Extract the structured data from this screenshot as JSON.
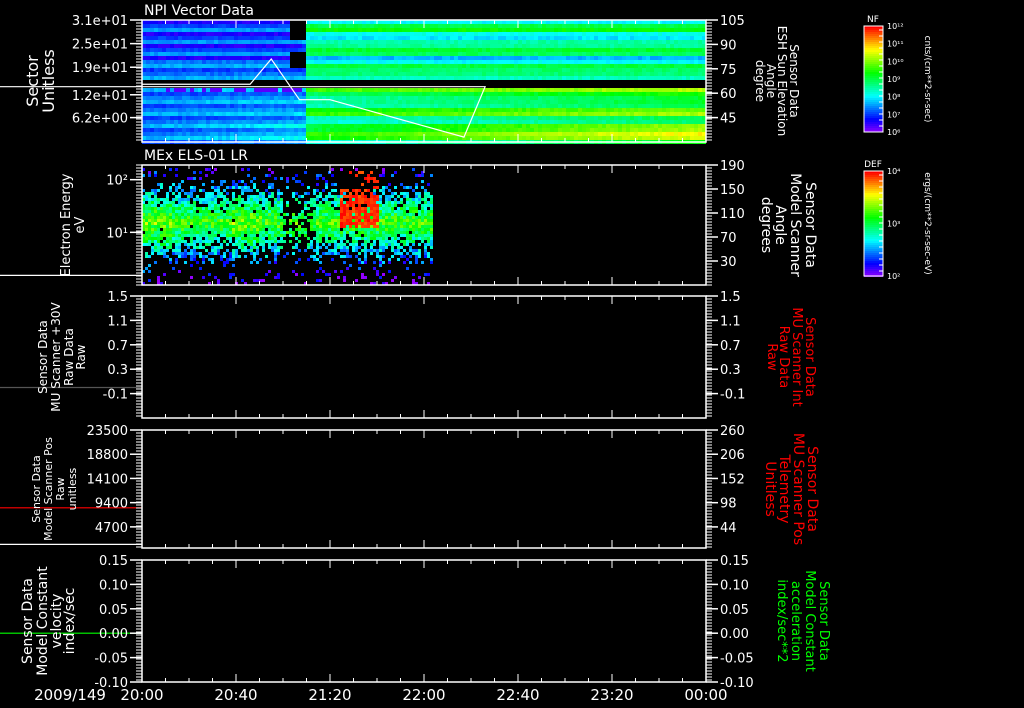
{
  "date_label": "2009/149",
  "time_ticks": [
    "20:00",
    "20:40",
    "21:20",
    "22:00",
    "22:40",
    "23:20",
    "00:00"
  ],
  "colors": {
    "background": "#000000",
    "axes": "#ffffff",
    "red_label": "#ff0000",
    "green_label": "#00ff00",
    "line_gray": "#555555"
  },
  "colorbars": [
    {
      "title": "NF",
      "labels": [
        "10¹²",
        "10¹¹",
        "10¹⁰",
        "10⁹",
        "10⁸",
        "10⁷",
        "10⁶"
      ],
      "unit": "cnts/(cm**2-sr-sec)",
      "colormap": "rainbow"
    },
    {
      "title": "DEF",
      "labels": [
        "10⁴",
        "10³",
        "10²"
      ],
      "unit": "ergs/(cm**2-sr-sec-eV)",
      "colormap": "rainbow"
    }
  ],
  "chart_data": [
    {
      "type": "heatmap",
      "title": "NPI Vector Data",
      "left_label": [
        "Sector",
        "Unitless"
      ],
      "left_ticks": [
        "3.1e+01",
        "2.5e+01",
        "1.9e+01",
        "1.2e+01",
        "6.2e+00"
      ],
      "left_tick_values": [
        31,
        25,
        19,
        12,
        6.2
      ],
      "ylim": [
        0,
        31
      ],
      "right_label": [
        "Sensor Data",
        "ESH Sun Elevation",
        "Angle",
        "degree"
      ],
      "right_ticks": [
        "105",
        "90",
        "75",
        "60",
        "45"
      ],
      "right_tick_values": [
        105,
        90,
        75,
        60,
        45
      ],
      "y2lim": [
        30,
        105
      ],
      "overlay_line": {
        "axis": "right",
        "color": "#ffffff",
        "x": [
          "20:00",
          "20:46",
          "20:55",
          "21:07",
          "21:20",
          "22:17",
          "22:26",
          "00:00"
        ],
        "y": [
          65.5,
          65.5,
          81,
          56,
          56,
          33,
          64,
          64
        ]
      }
    },
    {
      "type": "heatmap",
      "title": "MEx ELS-01 LR",
      "left_label": [
        "Electron Energy",
        "eV"
      ],
      "left_ticks": [
        "10²",
        "10¹"
      ],
      "left_tick_values": [
        100,
        10
      ],
      "ylim": [
        1,
        190
      ],
      "yscale": "log",
      "right_label": [
        "Sensor Data",
        "Model Scanner",
        "Angle",
        "degrees"
      ],
      "right_ticks": [
        "190",
        "150",
        "110",
        "70",
        "30"
      ],
      "right_tick_values": [
        190,
        150,
        110,
        70,
        30
      ],
      "y2lim": [
        -10,
        190
      ],
      "data_end_time": "22:03",
      "overlay_line": {
        "axis": "right",
        "color": "#ffffff",
        "x": [
          "20:00",
          "00:00"
        ],
        "y": [
          6,
          6
        ]
      }
    },
    {
      "type": "line",
      "title": "",
      "left_label": [
        "Sensor Data",
        "MU Scanner +30V",
        "Raw Data",
        "Raw"
      ],
      "left_ticks": [
        "1.5",
        "1.1",
        "0.7",
        "0.3",
        "-0.1"
      ],
      "left_tick_values": [
        1.5,
        1.1,
        0.7,
        0.3,
        -0.1
      ],
      "ylim": [
        -0.5,
        1.5
      ],
      "right_label": [
        "Sensor Data",
        "MU Scanner Int",
        "Raw Data",
        "Raw"
      ],
      "right_label_color": "#ff0000",
      "right_ticks": [
        "1.5",
        "1.1",
        "0.7",
        "0.3",
        "-0.1"
      ],
      "right_tick_values": [
        1.5,
        1.1,
        0.7,
        0.3,
        -0.1
      ],
      "y2lim": [
        -0.5,
        1.5
      ],
      "series": [
        {
          "axis": "left",
          "color": "#555555",
          "x": [
            "20:00",
            "00:00"
          ],
          "y": [
            0,
            0
          ]
        }
      ]
    },
    {
      "type": "line",
      "title": "",
      "left_label": [
        "Sensor Data",
        "Model Scanner Pos",
        "Raw",
        "unitless"
      ],
      "left_ticks": [
        "23500",
        "18800",
        "14100",
        "9400",
        "4700"
      ],
      "left_tick_values": [
        23500,
        18800,
        14100,
        9400,
        4700
      ],
      "ylim": [
        600,
        23500
      ],
      "right_label": [
        "Sensor Data",
        "MU Scanner Pos",
        "Telemetry",
        "Unitless"
      ],
      "right_label_color": "#ff0000",
      "right_ticks": [
        "260",
        "206",
        "152",
        "98",
        "44"
      ],
      "right_tick_values": [
        260,
        206,
        152,
        98,
        44
      ],
      "y2lim": [
        -3,
        260
      ],
      "series": [
        {
          "axis": "left",
          "color": "#ff0000",
          "x": [
            "20:00",
            "00:00"
          ],
          "y": [
            8400,
            8400
          ]
        }
      ],
      "overlay_line": {
        "axis": "right",
        "color": "#ffffff",
        "x": [
          "20:00",
          "00:00"
        ],
        "y": [
          5,
          5
        ]
      }
    },
    {
      "type": "line",
      "title": "",
      "left_label": [
        "Sensor Data",
        "Model Constant",
        "velocity",
        "index/sec"
      ],
      "left_ticks": [
        "0.15",
        "0.10",
        "0.05",
        "0.00",
        "-0.05",
        "-0.10"
      ],
      "left_tick_values": [
        0.15,
        0.1,
        0.05,
        0.0,
        -0.05,
        -0.1
      ],
      "ylim": [
        -0.1,
        0.15
      ],
      "right_label": [
        "Sensor Data",
        "Model Constant",
        "acceleration",
        "index/sec**2"
      ],
      "right_label_color": "#00ff00",
      "right_ticks": [
        "0.15",
        "0.10",
        "0.05",
        "0.00",
        "-0.05",
        "-0.10"
      ],
      "right_tick_values": [
        0.15,
        0.1,
        0.05,
        0.0,
        -0.05,
        -0.1
      ],
      "y2lim": [
        -0.1,
        0.15
      ],
      "series": [
        {
          "axis": "left",
          "color": "#00ff00",
          "x": [
            "20:00",
            "00:00"
          ],
          "y": [
            0,
            0
          ]
        }
      ]
    }
  ]
}
